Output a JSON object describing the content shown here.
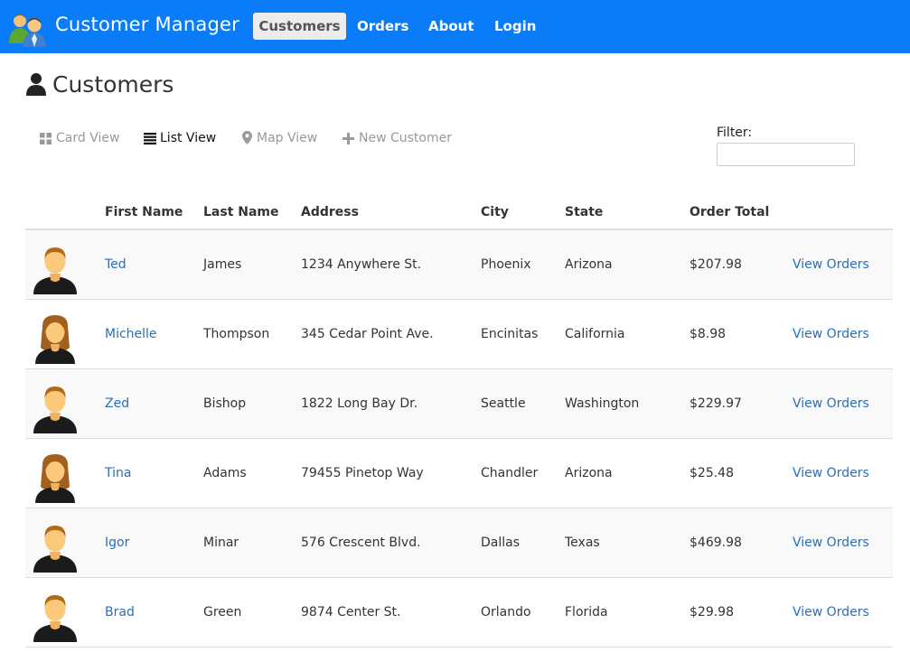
{
  "app": {
    "title": "Customer Manager"
  },
  "nav": [
    {
      "label": "Customers",
      "active": true
    },
    {
      "label": "Orders",
      "active": false
    },
    {
      "label": "About",
      "active": false
    },
    {
      "label": "Login",
      "active": false
    }
  ],
  "page": {
    "title": "Customers"
  },
  "views": [
    {
      "label": "Card View",
      "icon": "grid-icon",
      "active": false
    },
    {
      "label": "List View",
      "icon": "list-icon",
      "active": true
    },
    {
      "label": "Map View",
      "icon": "map-marker-icon",
      "active": false
    },
    {
      "label": "New Customer",
      "icon": "plus-icon",
      "active": false
    }
  ],
  "filter": {
    "label": "Filter:",
    "value": "",
    "placeholder": ""
  },
  "table": {
    "headers": [
      "First Name",
      "Last Name",
      "Address",
      "City",
      "State",
      "Order Total"
    ],
    "rows": [
      {
        "gender": "male",
        "first": "Ted",
        "last": "James",
        "address": "1234 Anywhere St.",
        "city": "Phoenix",
        "state": "Arizona",
        "total": "$207.98",
        "action": "View Orders"
      },
      {
        "gender": "female",
        "first": "Michelle",
        "last": "Thompson",
        "address": "345 Cedar Point Ave.",
        "city": "Encinitas",
        "state": "California",
        "total": "$8.98",
        "action": "View Orders"
      },
      {
        "gender": "male",
        "first": "Zed",
        "last": "Bishop",
        "address": "1822 Long Bay Dr.",
        "city": "Seattle",
        "state": "Washington",
        "total": "$229.97",
        "action": "View Orders"
      },
      {
        "gender": "female",
        "first": "Tina",
        "last": "Adams",
        "address": "79455 Pinetop Way",
        "city": "Chandler",
        "state": "Arizona",
        "total": "$25.48",
        "action": "View Orders"
      },
      {
        "gender": "male",
        "first": "Igor",
        "last": "Minar",
        "address": "576 Crescent Blvd.",
        "city": "Dallas",
        "state": "Texas",
        "total": "$469.98",
        "action": "View Orders"
      },
      {
        "gender": "male",
        "first": "Brad",
        "last": "Green",
        "address": "9874 Center St.",
        "city": "Orlando",
        "state": "Florida",
        "total": "$29.98",
        "action": "View Orders"
      }
    ]
  },
  "colors": {
    "navbar": "#0a7cf7",
    "link": "#2a6fb6",
    "stripe": "#f9f9f9"
  }
}
